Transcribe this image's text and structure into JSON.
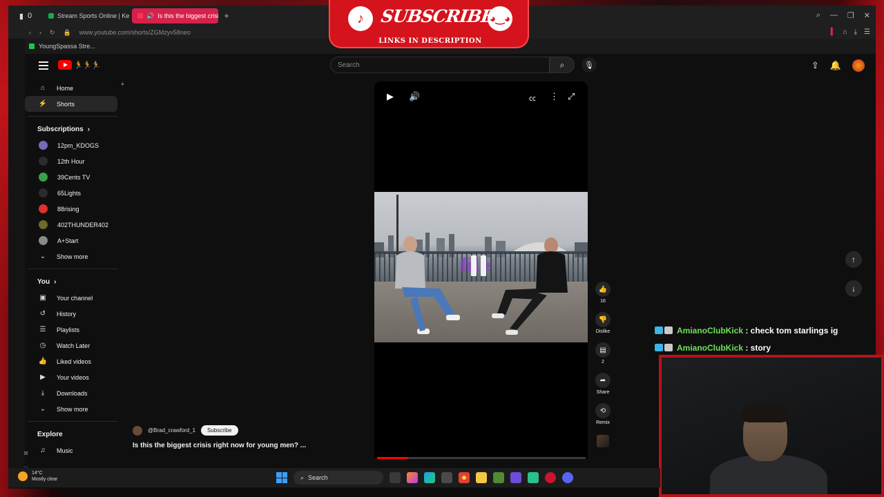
{
  "browser": {
    "tab_counter": "0",
    "tabs": [
      {
        "title": "Stream Sports Online | Ke",
        "active": false
      },
      {
        "title": "Is this the biggest crisis",
        "active": true
      }
    ],
    "url": "www.youtube.com/shorts/ZGMzyv58neo",
    "bookmark": "YoungSpassa Stre..."
  },
  "header": {
    "search_placeholder": "Search"
  },
  "sidebar": {
    "main": [
      {
        "label": "Home",
        "icon": "home-icon",
        "glyph": "⌂",
        "active": false
      },
      {
        "label": "Shorts",
        "icon": "shorts-icon",
        "glyph": "⚡",
        "active": true
      }
    ],
    "subscriptions_title": "Subscriptions",
    "subscriptions": [
      {
        "label": "12pm_KDOGS",
        "color": "#7a6ab8"
      },
      {
        "label": "12th Hour",
        "color": "#2c2c2c"
      },
      {
        "label": "39Cents TV",
        "color": "#3aa04a"
      },
      {
        "label": "65Lights",
        "color": "#2c2c2c"
      },
      {
        "label": "88rising",
        "color": "#e03030"
      },
      {
        "label": "402THUNDER402",
        "color": "#6b6b2a"
      },
      {
        "label": "A+Start",
        "color": "#8a8a8a"
      }
    ],
    "show_more_1": "Show more",
    "you_title": "You",
    "you_items": [
      {
        "label": "Your channel",
        "icon": "channel-icon",
        "glyph": "▣"
      },
      {
        "label": "History",
        "icon": "history-icon",
        "glyph": "↺"
      },
      {
        "label": "Playlists",
        "icon": "playlists-icon",
        "glyph": "☰"
      },
      {
        "label": "Watch Later",
        "icon": "clock-icon",
        "glyph": "◷"
      },
      {
        "label": "Liked videos",
        "icon": "thumbs-up-icon",
        "glyph": "👍"
      },
      {
        "label": "Your videos",
        "icon": "video-icon",
        "glyph": "▶"
      },
      {
        "label": "Downloads",
        "icon": "download-icon",
        "glyph": "⤓"
      }
    ],
    "show_more_2": "Show more",
    "explore_title": "Explore",
    "explore_items": [
      {
        "label": "Music",
        "icon": "music-icon",
        "glyph": "♫"
      }
    ]
  },
  "short": {
    "channel": "@Brad_crawford_1",
    "subscribe": "Subscribe",
    "title": "Is this the biggest crisis right now for young men? ...",
    "watermark": "file",
    "progress": 0.15,
    "likes": "16",
    "dislike_label": "Dislike",
    "comments": "2",
    "share_label": "Share",
    "remix_label": "Remix"
  },
  "overlay": {
    "banner_text": "SUBSCRIBE",
    "banner_sub": "LINKS IN DESCRIPTION"
  },
  "chat": [
    {
      "user": "AmianoClubKick",
      "message": " : check tom starlings ig"
    },
    {
      "user": "AmianoClubKick",
      "message": " : story"
    }
  ],
  "taskbar": {
    "temp": "14°C",
    "weather": "Mostly clear",
    "search": "Search"
  },
  "colors": {
    "accent": "#ff0000",
    "banner": "#d4131c",
    "chat_user": "#6ee15a"
  }
}
